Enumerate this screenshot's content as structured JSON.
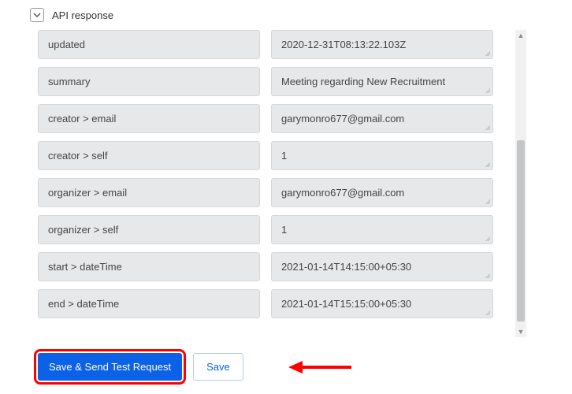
{
  "section": {
    "title": "API response"
  },
  "rows": [
    {
      "key": "updated",
      "value": "2020-12-31T08:13:22.103Z"
    },
    {
      "key": "summary",
      "value": "Meeting regarding New Recruitment"
    },
    {
      "key": "creator > email",
      "value": "garymonro677@gmail.com"
    },
    {
      "key": "creator > self",
      "value": "1"
    },
    {
      "key": "organizer > email",
      "value": "garymonro677@gmail.com"
    },
    {
      "key": "organizer > self",
      "value": "1"
    },
    {
      "key": "start > dateTime",
      "value": "2021-01-14T14:15:00+05:30"
    },
    {
      "key": "end > dateTime",
      "value": "2021-01-14T15:15:00+05:30"
    }
  ],
  "buttons": {
    "primary": "Save & Send Test Request",
    "secondary": "Save"
  },
  "colors": {
    "primary": "#0b62e6",
    "annotation": "#ff0000",
    "cell_bg": "#e7e8ea"
  }
}
